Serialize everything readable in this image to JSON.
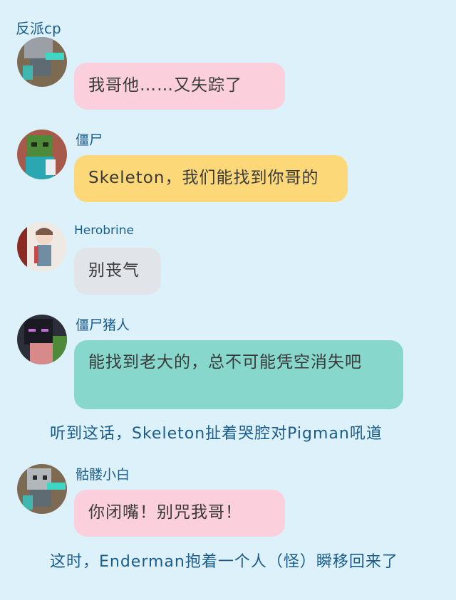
{
  "header": {
    "title": "反派cp"
  },
  "messages": [
    {
      "sender": "",
      "text": "我哥他……又失踪了",
      "bubble_color": "#fbd0dc"
    },
    {
      "sender": "僵尸",
      "text": "Skeleton，我们能找到你哥的",
      "bubble_color": "#fcd878"
    },
    {
      "sender": "Herobrine",
      "text": "别丧气",
      "bubble_color": "#e1e5ea"
    },
    {
      "sender": "僵尸猪人",
      "text": "能找到老大的，总不可能凭空消失吧",
      "bubble_color": "#87d7cc"
    },
    {
      "sender": "骷髅小白",
      "text": "你闭嘴！别咒我哥！",
      "bubble_color": "#fbd0dc"
    }
  ],
  "narration": [
    "听到这话，Skeleton扯着哭腔对Pigman吼道",
    "这时，Enderman抱着一个人（怪）瞬移回来了"
  ],
  "avatars": [
    "skeleton-avatar",
    "zombie-avatar",
    "herobrine-avatar",
    "zombie-pigman-avatar",
    "skeleton-avatar"
  ]
}
